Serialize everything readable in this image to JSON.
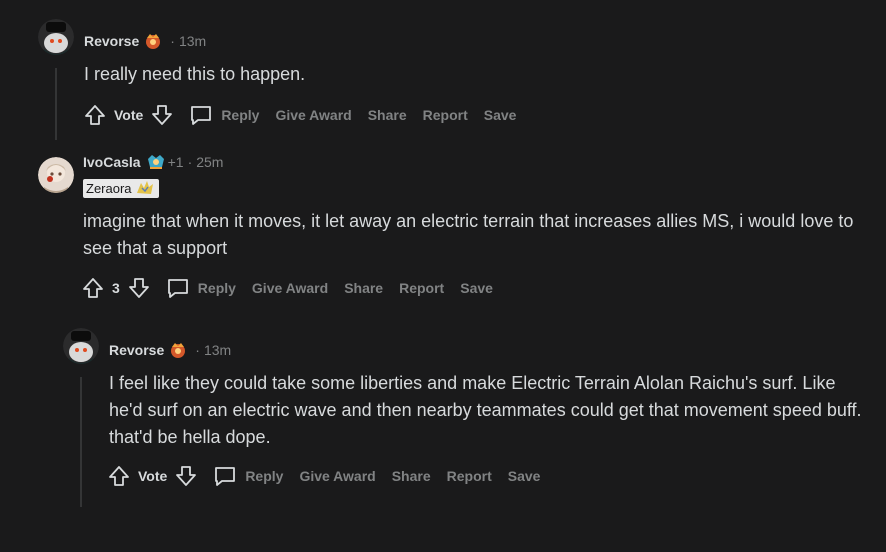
{
  "comments": [
    {
      "username": "Revorse",
      "flair_icon": "tier-flair-icon",
      "extra": "",
      "time": "13m",
      "user_flair": "",
      "body": "I really need this to happen.",
      "vote_label": "Vote",
      "actions": [
        "Reply",
        "Give Award",
        "Share",
        "Report",
        "Save"
      ]
    },
    {
      "username": "IvoCasla",
      "flair_icon": "tier-flair-icon",
      "extra": "+1",
      "time": "25m",
      "user_flair": "Zeraora",
      "body": "imagine that when it moves, it let away an electric terrain that increases allies MS, i would love to see that a support",
      "vote_label": "3",
      "actions": [
        "Reply",
        "Give Award",
        "Share",
        "Report",
        "Save"
      ]
    },
    {
      "username": "Revorse",
      "flair_icon": "tier-flair-icon",
      "extra": "",
      "time": "13m",
      "user_flair": "",
      "body": "I feel like they could take some liberties and make Electric Terrain Alolan Raichu's surf. Like he'd surf on an electric wave and then nearby teammates could get that movement speed buff. that'd be hella dope.",
      "vote_label": "Vote",
      "actions": [
        "Reply",
        "Give Award",
        "Share",
        "Report",
        "Save"
      ]
    }
  ],
  "colors": {
    "background": "#1a1a1b",
    "text": "#d7dadc",
    "muted": "#818384",
    "thread_line": "#343536"
  }
}
